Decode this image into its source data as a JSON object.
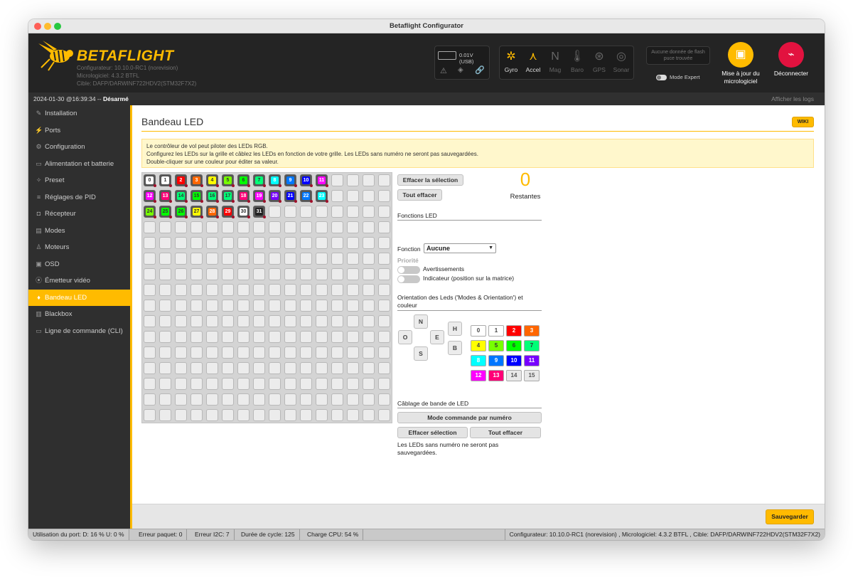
{
  "window": {
    "title": "Betaflight Configurator"
  },
  "header": {
    "logo": "BETAFLIGHT",
    "configurator": "Configurateur: 10.10.0-RC1 (norevision)",
    "firmware": "Micrologiciel: 4.3.2 BTFL",
    "target": "Cible: DAFP/DARWINF722HDV2(STM32F7X2)",
    "battery": "0.01V (USB)",
    "sensors": [
      "Gyro",
      "Accel",
      "Mag",
      "Baro",
      "GPS",
      "Sonar"
    ],
    "flash": "Aucune donnée de flash puce trouvée",
    "expert_mode": "Mode Expert",
    "update_fw": "Mise à jour du micrologiciel",
    "disconnect": "Déconnecter"
  },
  "status": {
    "datetime": "2024-01-30 @16:39:34 -- ",
    "armed": "Désarmé",
    "show_logs": "Afficher les logs"
  },
  "sidebar": {
    "items": [
      "Installation",
      "Ports",
      "Configuration",
      "Alimentation et batterie",
      "Preset",
      "Réglages de PID",
      "Récepteur",
      "Modes",
      "Moteurs",
      "OSD",
      "Émetteur vidéo",
      "Bandeau LED",
      "Blackbox",
      "Ligne de commande (CLI)"
    ],
    "active": "Bandeau LED"
  },
  "page": {
    "title": "Bandeau LED",
    "wiki": "WIKI",
    "note1": "Le contrôleur de vol peut piloter des LEDs RGB.",
    "note2": "Configurez les LEDs sur la grille et câblez les LEDs en fonction de votre grille. Les LEDs sans numéro ne seront pas sauvegardées.",
    "note3": "Double-cliquer sur une couleur pour éditer sa valeur.",
    "clear_selection": "Effacer la sélection",
    "clear_all": "Tout effacer",
    "remaining_count": "0",
    "remaining_label": "Restantes",
    "functions_title": "Fonctions LED",
    "function_label": "Fonction",
    "function_value": "Aucune",
    "priority": "Priorité",
    "warnings": "Avertissements",
    "indicator": "Indicateur (position sur la matrice)",
    "orientation_title": "Orientation des Leds ('Modes & Orientation') et couleur",
    "directions": {
      "n": "N",
      "o": "O",
      "e": "E",
      "s": "S",
      "h": "H",
      "b": "B"
    },
    "colors": [
      {
        "n": "0",
        "c": "#ffffff",
        "t": "#444"
      },
      {
        "n": "1",
        "c": "#ffffff",
        "t": "#444"
      },
      {
        "n": "2",
        "c": "#ff0000",
        "t": "#fff"
      },
      {
        "n": "3",
        "c": "#ff6600",
        "t": "#fff"
      },
      {
        "n": "4",
        "c": "#ffff00",
        "t": "#444"
      },
      {
        "n": "5",
        "c": "#77ff00",
        "t": "#333"
      },
      {
        "n": "6",
        "c": "#00ff00",
        "t": "#333"
      },
      {
        "n": "7",
        "c": "#00ff77",
        "t": "#333"
      },
      {
        "n": "8",
        "c": "#00ffff",
        "t": "#fff"
      },
      {
        "n": "9",
        "c": "#0077ff",
        "t": "#fff"
      },
      {
        "n": "10",
        "c": "#0000ff",
        "t": "#fff"
      },
      {
        "n": "11",
        "c": "#7700ff",
        "t": "#fff"
      },
      {
        "n": "12",
        "c": "#ff00ff",
        "t": "#fff"
      },
      {
        "n": "13",
        "c": "#ff0077",
        "t": "#fff"
      },
      {
        "n": "14",
        "c": "#e8e8e8",
        "t": "#555"
      },
      {
        "n": "15",
        "c": "#e8e8e8",
        "t": "#555"
      }
    ],
    "wiring_title": "Câblage de bande de LED",
    "wire_mode": "Mode commande par numéro",
    "wire_clear_sel": "Effacer sélection",
    "wire_clear_all": "Tout effacer",
    "wire_note": "Les LEDs sans numéro ne seront pas sauvegardées.",
    "save": "Sauvegarder"
  },
  "leds": [
    {
      "n": "0",
      "c": "#ffffff"
    },
    {
      "n": "1",
      "c": "#ffffff"
    },
    {
      "n": "2",
      "c": "#ff0000"
    },
    {
      "n": "3",
      "c": "#ff6600"
    },
    {
      "n": "4",
      "c": "#ffff00"
    },
    {
      "n": "5",
      "c": "#77ff00"
    },
    {
      "n": "6",
      "c": "#00ff00"
    },
    {
      "n": "7",
      "c": "#00ff77"
    },
    {
      "n": "8",
      "c": "#00ffff"
    },
    {
      "n": "9",
      "c": "#0077ff"
    },
    {
      "n": "10",
      "c": "#0000ff"
    },
    {
      "n": "11",
      "c": "#ff00ff"
    },
    {
      "n": "12",
      "c": "#ff00ff"
    },
    {
      "n": "13",
      "c": "#ff0077"
    },
    {
      "n": "14",
      "c": "#00ff77"
    },
    {
      "n": "15",
      "c": "#00ff00"
    },
    {
      "n": "16",
      "c": "#00ff77"
    },
    {
      "n": "17",
      "c": "#00ff77"
    },
    {
      "n": "18",
      "c": "#ff0077"
    },
    {
      "n": "19",
      "c": "#ff00ff"
    },
    {
      "n": "20",
      "c": "#7700ff"
    },
    {
      "n": "21",
      "c": "#0000ff"
    },
    {
      "n": "22",
      "c": "#0077ff"
    },
    {
      "n": "23",
      "c": "#00ffff"
    },
    {
      "n": "24",
      "c": "#77ff00"
    },
    {
      "n": "25",
      "c": "#00ff00"
    },
    {
      "n": "26",
      "c": "#00ff00"
    },
    {
      "n": "27",
      "c": "#ffff00"
    },
    {
      "n": "28",
      "c": "#ff6600"
    },
    {
      "n": "29",
      "c": "#ff0000"
    },
    {
      "n": "30",
      "c": "#ffffff"
    },
    {
      "n": "31",
      "c": "#222222"
    }
  ],
  "bottom": {
    "port": "Utilisation du port: D: 16 % U: 0 %",
    "packet": "Erreur paquet: 0",
    "i2c": "Erreur I2C: 7",
    "cycle": "Durée de cycle: 125",
    "cpu": "Charge CPU: 54 %",
    "version": "Configurateur: 10.10.0-RC1 (norevision) , Micrologiciel: 4.3.2 BTFL , Cible: DAFP/DARWINF722HDV2(STM32F7X2)"
  }
}
